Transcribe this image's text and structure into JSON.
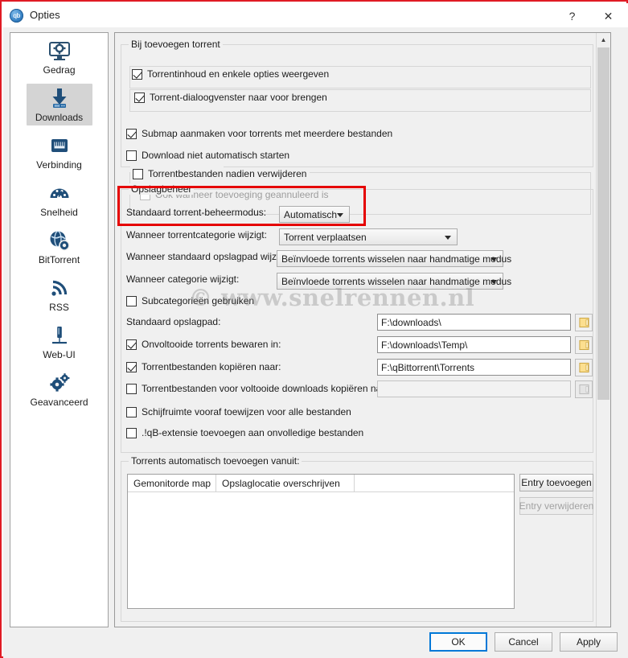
{
  "window": {
    "title": "Opties",
    "icon": "qbittorrent-logo-icon",
    "help_label": "?",
    "close_label": "✕",
    "accent_color": "#0078d7",
    "border_color": "#e01b24",
    "highlight_color": "#e50000"
  },
  "watermark": "© www.snelrennen.nl",
  "sidebar": {
    "items": [
      {
        "label": "Gedrag",
        "icon": "monitor-gear-icon",
        "selected": false
      },
      {
        "label": "Downloads",
        "icon": "download-arrow-icon",
        "selected": true
      },
      {
        "label": "Verbinding",
        "icon": "network-port-icon",
        "selected": false
      },
      {
        "label": "Snelheid",
        "icon": "speedometer-icon",
        "selected": false
      },
      {
        "label": "BitTorrent",
        "icon": "globe-gear-icon",
        "selected": false
      },
      {
        "label": "RSS",
        "icon": "rss-feed-icon",
        "selected": false
      },
      {
        "label": "Web-UI",
        "icon": "web-ui-icon",
        "selected": false
      },
      {
        "label": "Geavanceerd",
        "icon": "gears-icon",
        "selected": false
      }
    ]
  },
  "scrollbar": {
    "up_arrow": "▲",
    "position_percent": 0
  },
  "add_torrent_group": {
    "title": "Bij toevoegen torrent",
    "checkboxes": [
      {
        "label": "Torrentinhoud en enkele opties weergeven",
        "checked": true,
        "enabled": true
      },
      {
        "label": "Torrent-dialoogvenster naar voor brengen",
        "checked": true,
        "enabled": true
      },
      {
        "label": "Submap aanmaken voor torrents met meerdere bestanden",
        "checked": true,
        "enabled": true
      },
      {
        "label": "Download niet automatisch starten",
        "checked": false,
        "enabled": true
      },
      {
        "label": "Torrentbestanden nadien verwijderen",
        "checked": false,
        "enabled": true
      },
      {
        "label": "Ook wanneer toevoeging geannuleerd is",
        "checked": false,
        "enabled": false
      }
    ]
  },
  "storage_group": {
    "title": "Opslagbeheer",
    "highlighted": true,
    "dropdowns": [
      {
        "label": "Standaard torrent-beheermodus:",
        "value": "Automatisch"
      },
      {
        "label": "Wanneer torrentcategorie wijzigt:",
        "value": "Torrent verplaatsen"
      },
      {
        "label": "Wanneer standaard opslagpad wijzigt:",
        "value": "Beïnvloede torrents wisselen naar handmatige modus"
      },
      {
        "label": "Wanneer categorie wijzigt:",
        "value": "Beïnvloede torrents wisselen naar handmatige modus"
      }
    ],
    "subcategories_checkbox": {
      "label": "Subcategorieën gebruiken",
      "checked": false
    },
    "paths": [
      {
        "label": "Standaard opslagpad:",
        "has_checkbox": false,
        "checked": false,
        "value": "F:\\downloads\\",
        "enabled": true,
        "browse_icon": "folder-icon"
      },
      {
        "label": "Onvoltooide torrents bewaren in:",
        "has_checkbox": true,
        "checked": true,
        "value": "F:\\downloads\\Temp\\",
        "enabled": true,
        "browse_icon": "folder-icon"
      },
      {
        "label": "Torrentbestanden kopiëren naar:",
        "has_checkbox": true,
        "checked": true,
        "value": "F:\\qBittorrent\\Torrents",
        "enabled": true,
        "browse_icon": "folder-icon"
      },
      {
        "label": "Torrentbestanden voor voltooide downloads kopiëren naar:",
        "has_checkbox": true,
        "checked": false,
        "value": "",
        "enabled": false,
        "browse_icon": "folder-icon"
      }
    ],
    "trailing_checkboxes": [
      {
        "label": "Schijfruimte vooraf toewijzen voor alle bestanden",
        "checked": false
      },
      {
        "label": ".!qB-extensie toevoegen aan onvolledige bestanden",
        "checked": false
      }
    ]
  },
  "watch_group": {
    "title": "Torrents automatisch toevoegen vanuit:",
    "columns": [
      "Gemonitorde map",
      "Opslaglocatie overschrijven"
    ],
    "rows": [],
    "buttons": [
      {
        "label": "Entry toevoegen",
        "enabled": true
      },
      {
        "label": "Entry verwijderen",
        "enabled": false
      }
    ]
  },
  "footer": {
    "buttons": [
      {
        "label": "OK",
        "default": true
      },
      {
        "label": "Cancel",
        "default": false
      },
      {
        "label": "Apply",
        "default": false
      }
    ]
  }
}
